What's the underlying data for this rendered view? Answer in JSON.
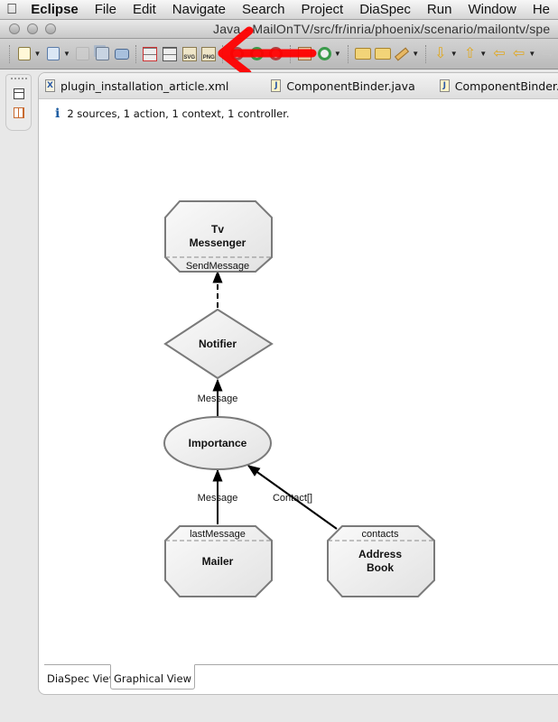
{
  "menubar": {
    "app": "Eclipse",
    "items": [
      "File",
      "Edit",
      "Navigate",
      "Search",
      "Project",
      "DiaSpec",
      "Run",
      "Window",
      "He"
    ]
  },
  "window": {
    "title": "Java - MailOnTV/src/fr/inria/phoenix/scenario/mailontv/spe"
  },
  "toolbar": {
    "buttons": [
      {
        "icon": "new-project-icon",
        "has_dropdown": true
      },
      {
        "icon": "new-file-icon",
        "has_dropdown": true
      },
      {
        "icon": "save-icon",
        "disabled": true
      },
      {
        "icon": "save-all-icon"
      },
      {
        "icon": "print-icon"
      },
      {
        "icon": "layout-icon"
      },
      {
        "icon": "layout-flat-icon"
      },
      {
        "icon": "export-svg-icon",
        "label": "SVG"
      },
      {
        "icon": "export-png-icon",
        "label": "PNG"
      },
      {
        "icon": "debug-icon"
      },
      {
        "icon": "run-icon"
      },
      {
        "icon": "external-tools-icon"
      },
      {
        "icon": "new-class-icon"
      },
      {
        "icon": "new-component-icon"
      },
      {
        "icon": "open-type-icon"
      },
      {
        "icon": "open-resource-icon"
      },
      {
        "icon": "pen-icon",
        "has_dropdown": true
      },
      {
        "icon": "next-annotation-icon",
        "has_dropdown": true
      },
      {
        "icon": "previous-annotation-icon",
        "has_dropdown": true
      },
      {
        "icon": "last-edit-icon"
      },
      {
        "icon": "back-icon",
        "has_dropdown": true
      },
      {
        "icon": "forward-icon",
        "disabled": true
      }
    ],
    "annotation_color": "#ff0000"
  },
  "editor": {
    "tabs": [
      {
        "label": "plugin_installation_article.xml",
        "icon": "X"
      },
      {
        "label": "ComponentBinder.java",
        "icon": "J"
      },
      {
        "label": "ComponentBinder.java",
        "icon": "J"
      }
    ],
    "info": "2 sources, 1 action, 1 context, 1 controller.",
    "bottom_tabs": [
      {
        "label": "DiaSpec View",
        "active": false
      },
      {
        "label": "Graphical View",
        "active": true
      }
    ]
  },
  "diagram": {
    "nodes": {
      "tv_messenger": {
        "line1": "Tv",
        "line2": "Messenger",
        "port": "SendMessage",
        "kind": "device"
      },
      "notifier": {
        "label": "Notifier",
        "kind": "controller"
      },
      "importance": {
        "label": "Importance",
        "kind": "context"
      },
      "mailer": {
        "label": "Mailer",
        "port": "lastMessage",
        "kind": "device"
      },
      "address_book": {
        "line1": "Address",
        "line2": "Book",
        "port": "contacts",
        "kind": "device"
      }
    },
    "edges": [
      {
        "from": "notifier",
        "to": "tv_messenger",
        "label": "",
        "style": "dashed"
      },
      {
        "from": "importance",
        "to": "notifier",
        "label": "Message",
        "style": "solid"
      },
      {
        "from": "mailer",
        "to": "importance",
        "label": "Message",
        "style": "solid"
      },
      {
        "from": "address_book",
        "to": "importance",
        "label": "Contact[]",
        "style": "solid"
      }
    ]
  }
}
